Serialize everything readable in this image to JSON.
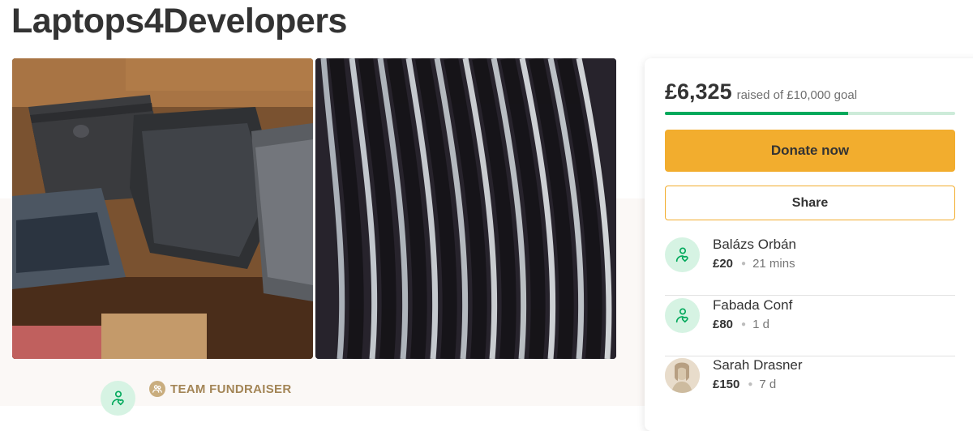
{
  "page": {
    "title": "Laptops4Developers"
  },
  "photos": [
    {
      "name": "laptops-stack-photo"
    },
    {
      "name": "laptops-closeup-photo"
    }
  ],
  "donation_card": {
    "raised_amount": "£6,325",
    "goal_text": "raised of £10,000 goal",
    "progress": 0.6325,
    "donate_label": "Donate now",
    "share_label": "Share",
    "donors": [
      {
        "name": "Balázs Orbán",
        "amount": "£20",
        "time": "21 mins",
        "avatar": "heart-hand-icon"
      },
      {
        "name": "Fabada Conf",
        "amount": "£80",
        "time": "1 d",
        "avatar": "heart-hand-icon"
      },
      {
        "name": "Sarah Drasner",
        "amount": "£150",
        "time": "7 d",
        "avatar": "profile-photo"
      }
    ]
  },
  "organizer": {
    "team_label": "TEAM FUNDRAISER",
    "avatar": "heart-hand-icon"
  },
  "colors": {
    "accent": "#f2ad2e",
    "progress": "#02a95c",
    "progress_track": "#cdebd9",
    "team_label": "#a38556"
  }
}
